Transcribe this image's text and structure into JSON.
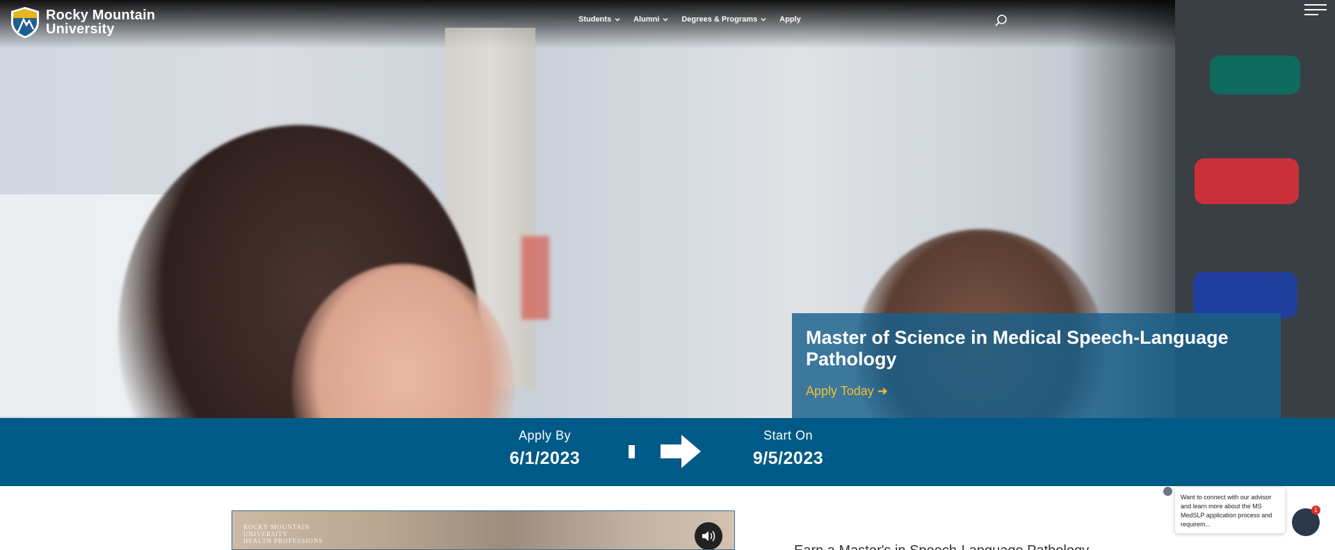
{
  "header": {
    "logo_line1": "Rocky Mountain",
    "logo_line2": "University",
    "nav": [
      {
        "label": "Students",
        "has_dropdown": true
      },
      {
        "label": "Alumni",
        "has_dropdown": true
      },
      {
        "label": "Degrees & Programs",
        "has_dropdown": true
      },
      {
        "label": "Apply",
        "has_dropdown": false
      }
    ],
    "search_icon": "search-icon",
    "menu_icon": "hamburger-menu-icon"
  },
  "hero": {
    "program_title": "Master of Science in Medical Speech-Language Pathology",
    "apply_link": "Apply Today ➜"
  },
  "dates": {
    "apply_by_label": "Apply By",
    "apply_by_value": "6/1/2023",
    "start_on_label": "Start On",
    "start_on_value": "9/5/2023"
  },
  "video": {
    "logo_lines": [
      "ROCKY MOUNTAIN",
      "UNIVERSITY",
      "HEALTH PROFESSIONS"
    ],
    "sound_icon": "volume-icon"
  },
  "content": {
    "section_heading": "Earn a Master's in Speech-Language Pathology"
  },
  "chat": {
    "message": "Want to connect with our advisor and learn more about the MS MedSLP application process and requirem...",
    "badge_count": "1"
  },
  "colors": {
    "band": "#005a87",
    "card": "#18608c",
    "accent_yellow": "#f2c230"
  }
}
